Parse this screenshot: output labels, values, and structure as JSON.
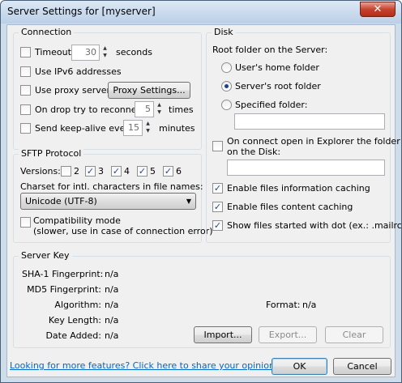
{
  "window": {
    "title": "Server Settings for [myserver]",
    "close": "✕"
  },
  "connection": {
    "title": "Connection",
    "timeout_label": "Timeout:",
    "timeout_value": "30",
    "timeout_unit": "seconds",
    "ipv6_label": "Use IPv6 addresses",
    "proxy_label": "Use proxy server",
    "proxy_button": "Proxy Settings...",
    "reconnect_label": "On drop try to reconnect",
    "reconnect_value": "5",
    "reconnect_unit": "times",
    "keepalive_label": "Send keep-alive every",
    "keepalive_value": "15",
    "keepalive_unit": "minutes"
  },
  "sftp": {
    "title": "SFTP Protocol",
    "versions_label": "Versions:",
    "versions": [
      {
        "label": "2",
        "checked": false
      },
      {
        "label": "3",
        "checked": true
      },
      {
        "label": "4",
        "checked": true
      },
      {
        "label": "5",
        "checked": true
      },
      {
        "label": "6",
        "checked": true
      }
    ],
    "charset_label": "Charset for intl. characters in file names:",
    "charset_value": "Unicode (UTF-8)",
    "compat_label1": "Compatibility mode",
    "compat_label2": "(slower, use in case of connection error)"
  },
  "disk": {
    "title": "Disk",
    "root_label": "Root folder on the Server:",
    "opt_home": "User's home folder",
    "opt_root": "Server's root folder",
    "opt_specified": "Specified folder:",
    "connect_label1": "On connect open in Explorer the folder",
    "connect_label2": "on the Disk:",
    "caching_info": "Enable files information caching",
    "caching_content": "Enable files content caching",
    "show_dot": "Show files started with dot (ex.: .mailrc)"
  },
  "serverkey": {
    "title": "Server Key",
    "sha1_label": "SHA-1 Fingerprint:",
    "sha1_value": "n/a",
    "md5_label": "MD5 Fingerprint:",
    "md5_value": "n/a",
    "algo_label": "Algorithm:",
    "algo_value": "n/a",
    "keylen_label": "Key Length:",
    "keylen_value": "n/a",
    "date_label": "Date Added:",
    "date_value": "n/a",
    "format_label": "Format:",
    "format_value": "n/a",
    "import_button": "Import...",
    "export_button": "Export...",
    "clear_button": "Clear"
  },
  "footer": {
    "link": "Looking for more features? Click here to share your opinion.",
    "ok": "OK",
    "cancel": "Cancel"
  }
}
